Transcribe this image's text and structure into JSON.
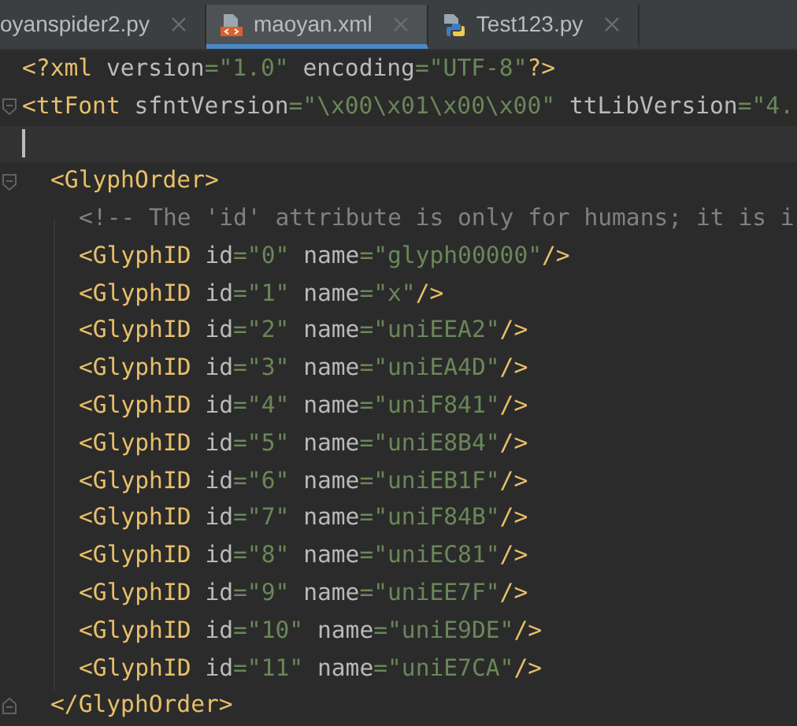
{
  "tabs": [
    {
      "label": "oyanspider2.py",
      "kind": "python-cut",
      "selected": false
    },
    {
      "label": "maoyan.xml",
      "kind": "xml",
      "selected": true
    },
    {
      "label": "Test123.py",
      "kind": "python",
      "selected": false
    }
  ],
  "editor": {
    "lines": [
      {
        "kind": "line",
        "current": false,
        "tokens": [
          {
            "kind": "tag",
            "text": "<?xml"
          },
          {
            "kind": "attr",
            "text": " version"
          },
          {
            "kind": "value",
            "text": "=\"1.0\""
          },
          {
            "kind": "attr",
            "text": " encoding"
          },
          {
            "kind": "value",
            "text": "=\"UTF-8\""
          },
          {
            "kind": "tag",
            "text": "?>"
          }
        ]
      },
      {
        "kind": "open",
        "current": false,
        "expanded": true,
        "tokens": [
          {
            "kind": "tag",
            "text": "<ttFont"
          },
          {
            "kind": "attr",
            "text": " sfntVersion"
          },
          {
            "kind": "value",
            "text": "=\"\\x00\\x01\\x00\\x00\""
          },
          {
            "kind": "attr",
            "text": " ttLibVersion"
          },
          {
            "kind": "value",
            "text": "=\"4."
          }
        ],
        "children": [
          {
            "kind": "line",
            "current": true
          },
          {
            "kind": "open",
            "current": false,
            "expanded": true,
            "tokens": [
              {
                "kind": "tag",
                "text": "<GlyphOrder>"
              }
            ],
            "children": [
              {
                "kind": "line",
                "current": false,
                "tokens": [
                  {
                    "kind": "comment",
                    "text": "<!-- The 'id' attribute is only for humans; it is i"
                  }
                ]
              },
              {
                "kind": "line",
                "current": false,
                "tokens": [
                  {
                    "kind": "tag",
                    "text": "<GlyphID"
                  },
                  {
                    "kind": "attr",
                    "text": " id"
                  },
                  {
                    "kind": "value",
                    "text": "=\"0\""
                  },
                  {
                    "kind": "attr",
                    "text": " name"
                  },
                  {
                    "kind": "value",
                    "text": "=\"glyph00000\""
                  },
                  {
                    "kind": "tag",
                    "text": "/>"
                  }
                ]
              },
              {
                "kind": "line",
                "current": false,
                "tokens": [
                  {
                    "kind": "tag",
                    "text": "<GlyphID"
                  },
                  {
                    "kind": "attr",
                    "text": " id"
                  },
                  {
                    "kind": "value",
                    "text": "=\"1\""
                  },
                  {
                    "kind": "attr",
                    "text": " name"
                  },
                  {
                    "kind": "value",
                    "text": "=\"x\""
                  },
                  {
                    "kind": "tag",
                    "text": "/>"
                  }
                ]
              },
              {
                "kind": "line",
                "current": false,
                "tokens": [
                  {
                    "kind": "tag",
                    "text": "<GlyphID"
                  },
                  {
                    "kind": "attr",
                    "text": " id"
                  },
                  {
                    "kind": "value",
                    "text": "=\"2\""
                  },
                  {
                    "kind": "attr",
                    "text": " name"
                  },
                  {
                    "kind": "value",
                    "text": "=\"uniEEA2\""
                  },
                  {
                    "kind": "tag",
                    "text": "/>"
                  }
                ]
              },
              {
                "kind": "line",
                "current": false,
                "tokens": [
                  {
                    "kind": "tag",
                    "text": "<GlyphID"
                  },
                  {
                    "kind": "attr",
                    "text": " id"
                  },
                  {
                    "kind": "value",
                    "text": "=\"3\""
                  },
                  {
                    "kind": "attr",
                    "text": " name"
                  },
                  {
                    "kind": "value",
                    "text": "=\"uniEA4D\""
                  },
                  {
                    "kind": "tag",
                    "text": "/>"
                  }
                ]
              },
              {
                "kind": "line",
                "current": false,
                "tokens": [
                  {
                    "kind": "tag",
                    "text": "<GlyphID"
                  },
                  {
                    "kind": "attr",
                    "text": " id"
                  },
                  {
                    "kind": "value",
                    "text": "=\"4\""
                  },
                  {
                    "kind": "attr",
                    "text": " name"
                  },
                  {
                    "kind": "value",
                    "text": "=\"uniF841\""
                  },
                  {
                    "kind": "tag",
                    "text": "/>"
                  }
                ]
              },
              {
                "kind": "line",
                "current": false,
                "tokens": [
                  {
                    "kind": "tag",
                    "text": "<GlyphID"
                  },
                  {
                    "kind": "attr",
                    "text": " id"
                  },
                  {
                    "kind": "value",
                    "text": "=\"5\""
                  },
                  {
                    "kind": "attr",
                    "text": " name"
                  },
                  {
                    "kind": "value",
                    "text": "=\"uniE8B4\""
                  },
                  {
                    "kind": "tag",
                    "text": "/>"
                  }
                ]
              },
              {
                "kind": "line",
                "current": false,
                "tokens": [
                  {
                    "kind": "tag",
                    "text": "<GlyphID"
                  },
                  {
                    "kind": "attr",
                    "text": " id"
                  },
                  {
                    "kind": "value",
                    "text": "=\"6\""
                  },
                  {
                    "kind": "attr",
                    "text": " name"
                  },
                  {
                    "kind": "value",
                    "text": "=\"uniEB1F\""
                  },
                  {
                    "kind": "tag",
                    "text": "/>"
                  }
                ]
              },
              {
                "kind": "line",
                "current": false,
                "tokens": [
                  {
                    "kind": "tag",
                    "text": "<GlyphID"
                  },
                  {
                    "kind": "attr",
                    "text": " id"
                  },
                  {
                    "kind": "value",
                    "text": "=\"7\""
                  },
                  {
                    "kind": "attr",
                    "text": " name"
                  },
                  {
                    "kind": "value",
                    "text": "=\"uniF84B\""
                  },
                  {
                    "kind": "tag",
                    "text": "/>"
                  }
                ]
              },
              {
                "kind": "line",
                "current": false,
                "tokens": [
                  {
                    "kind": "tag",
                    "text": "<GlyphID"
                  },
                  {
                    "kind": "attr",
                    "text": " id"
                  },
                  {
                    "kind": "value",
                    "text": "=\"8\""
                  },
                  {
                    "kind": "attr",
                    "text": " name"
                  },
                  {
                    "kind": "value",
                    "text": "=\"uniEC81\""
                  },
                  {
                    "kind": "tag",
                    "text": "/>"
                  }
                ]
              },
              {
                "kind": "line",
                "current": false,
                "tokens": [
                  {
                    "kind": "tag",
                    "text": "<GlyphID"
                  },
                  {
                    "kind": "attr",
                    "text": " id"
                  },
                  {
                    "kind": "value",
                    "text": "=\"9\""
                  },
                  {
                    "kind": "attr",
                    "text": " name"
                  },
                  {
                    "kind": "value",
                    "text": "=\"uniEE7F\""
                  },
                  {
                    "kind": "tag",
                    "text": "/>"
                  }
                ]
              },
              {
                "kind": "line",
                "current": false,
                "tokens": [
                  {
                    "kind": "tag",
                    "text": "<GlyphID"
                  },
                  {
                    "kind": "attr",
                    "text": " id"
                  },
                  {
                    "kind": "value",
                    "text": "=\"10\""
                  },
                  {
                    "kind": "attr",
                    "text": " name"
                  },
                  {
                    "kind": "value",
                    "text": "=\"uniE9DE\""
                  },
                  {
                    "kind": "tag",
                    "text": "/>"
                  }
                ]
              },
              {
                "kind": "line",
                "current": false,
                "tokens": [
                  {
                    "kind": "tag",
                    "text": "<GlyphID"
                  },
                  {
                    "kind": "attr",
                    "text": " id"
                  },
                  {
                    "kind": "value",
                    "text": "=\"11\""
                  },
                  {
                    "kind": "attr",
                    "text": " name"
                  },
                  {
                    "kind": "value",
                    "text": "=\"uniE7CA\""
                  },
                  {
                    "kind": "tag",
                    "text": "/>"
                  }
                ]
              }
            ]
          },
          {
            "kind": "close",
            "current": false,
            "tokens": [
              {
                "kind": "tag",
                "text": "</GlyphOrder>"
              }
            ]
          }
        ]
      }
    ]
  }
}
